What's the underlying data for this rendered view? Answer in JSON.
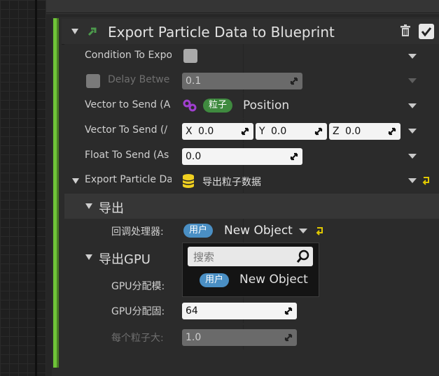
{
  "node": {
    "title": "Export Particle Data to Blueprint"
  },
  "rows": {
    "condition": {
      "label": "Condition To Expo"
    },
    "delay": {
      "label": "Delay Betwe",
      "value": "0.1"
    },
    "vector": {
      "label": "Vector to Send (A",
      "tag": "粒子",
      "value": "Position"
    },
    "vector_to": {
      "label": "Vector To Send (/",
      "x_label": "X",
      "x_value": "0.0",
      "y_label": "Y",
      "y_value": "0.0",
      "z_label": "Z",
      "z_value": "0.0"
    },
    "float": {
      "label": "Float To Send (As",
      "value": "0.0"
    },
    "export": {
      "label": "Export Particle Da",
      "value": "导出粒子数据"
    }
  },
  "sections": {
    "export": {
      "title": "导出",
      "callback": {
        "label": "回调处理器:",
        "tag": "用户",
        "value": "New Object"
      }
    },
    "gpu": {
      "title": "导出GPU",
      "alloc_mode": {
        "label": "GPU分配模:"
      },
      "alloc_fixed": {
        "label": "GPU分配固:",
        "value": "64"
      },
      "per_particle": {
        "label": "每个粒子大:",
        "value": "1.0"
      }
    }
  },
  "popup": {
    "search_placeholder": "搜索",
    "option_tag": "用户",
    "option_value": "New Object"
  },
  "colors": {
    "accent_green": "#6ec338",
    "tag_blue": "#4a8fc4",
    "tag_green": "#3f8a3f",
    "vector_purple": "#a03fd0",
    "data_yellow": "#f0d020"
  }
}
